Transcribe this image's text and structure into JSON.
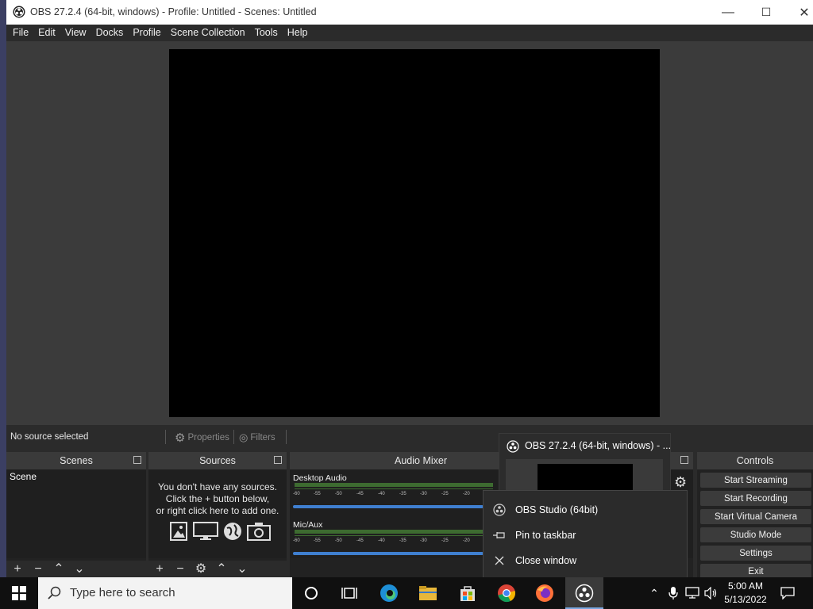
{
  "window": {
    "title": "OBS 27.2.4 (64-bit, windows) - Profile: Untitled - Scenes: Untitled",
    "controls": {
      "minimize": "—",
      "maximize": "☐",
      "close": "✕"
    }
  },
  "menu": [
    "File",
    "Edit",
    "View",
    "Docks",
    "Profile",
    "Scene Collection",
    "Tools",
    "Help"
  ],
  "source_toolbar": {
    "status": "No source selected",
    "properties_label": "Properties",
    "filters_label": "Filters"
  },
  "scenes": {
    "title": "Scenes",
    "items": [
      "Scene"
    ]
  },
  "sources": {
    "title": "Sources",
    "empty_line1": "You don't have any sources.",
    "empty_line2": "Click the + button below,",
    "empty_line3": "or right click here to add one."
  },
  "audio_mixer": {
    "title": "Audio Mixer",
    "tracks": [
      {
        "name": "Desktop Audio"
      },
      {
        "name": "Mic/Aux"
      }
    ],
    "scale": [
      "-60",
      "-55",
      "-50",
      "-45",
      "-40",
      "-35",
      "-30",
      "-25",
      "-20"
    ]
  },
  "controls": {
    "title": "Controls",
    "buttons": [
      "Start Streaming",
      "Start Recording",
      "Start Virtual Camera",
      "Studio Mode",
      "Settings",
      "Exit"
    ]
  },
  "thumbnail": {
    "title": "OBS 27.2.4 (64-bit, windows) - ..."
  },
  "jumplist": {
    "app": "OBS Studio (64bit)",
    "pin": "Pin to taskbar",
    "close": "Close window"
  },
  "taskbar": {
    "search_placeholder": "Type here to search",
    "time": "5:00 AM",
    "date": "5/13/2022"
  },
  "colors": {
    "accent": "#3f7fd0",
    "meter": "#3d6b30",
    "taskbar": "#101010"
  }
}
